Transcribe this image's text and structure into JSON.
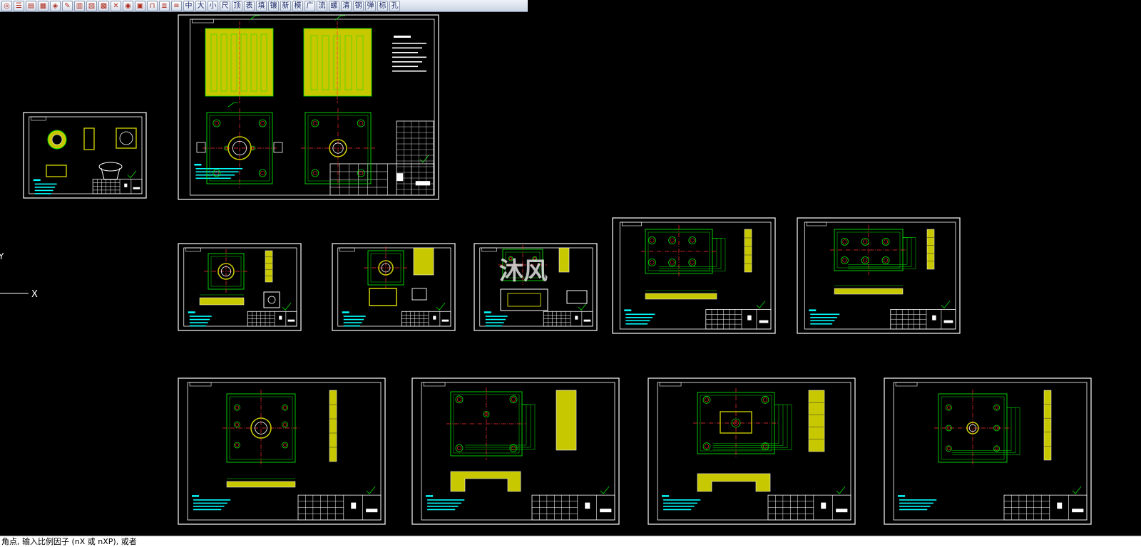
{
  "toolbar": {
    "buttons": [
      {
        "kind": "icon",
        "name": "draw-circle-icon",
        "glyph": "◎"
      },
      {
        "kind": "icon",
        "name": "list-icon",
        "glyph": "☰"
      },
      {
        "kind": "icon",
        "name": "bars-icon",
        "glyph": "▤"
      },
      {
        "kind": "icon",
        "name": "table-icon",
        "glyph": "▦"
      },
      {
        "kind": "icon",
        "name": "shape-icon",
        "glyph": "◈"
      },
      {
        "kind": "icon",
        "name": "pencil-icon",
        "glyph": "✎"
      },
      {
        "kind": "icon",
        "name": "grid-icon",
        "glyph": "▥"
      },
      {
        "kind": "icon",
        "name": "columns-icon",
        "glyph": "▧"
      },
      {
        "kind": "icon",
        "name": "block-icon",
        "glyph": "▩"
      },
      {
        "kind": "icon",
        "name": "tools-icon",
        "glyph": "✕"
      },
      {
        "kind": "icon",
        "name": "target-icon",
        "glyph": "◉"
      },
      {
        "kind": "icon",
        "name": "frame-icon",
        "glyph": "▣"
      },
      {
        "kind": "icon",
        "name": "dimension-icon",
        "glyph": "⊓"
      },
      {
        "kind": "icon",
        "name": "layers-icon",
        "glyph": "≣"
      },
      {
        "kind": "icon",
        "name": "stack-icon",
        "glyph": "≡"
      },
      {
        "kind": "text",
        "name": "center-button",
        "glyph": "中"
      },
      {
        "kind": "text",
        "name": "big-button",
        "glyph": "大"
      },
      {
        "kind": "text",
        "name": "small-button",
        "glyph": "小"
      },
      {
        "kind": "text",
        "name": "size-button",
        "glyph": "尺"
      },
      {
        "kind": "text",
        "name": "top-button",
        "glyph": "顶"
      },
      {
        "kind": "text",
        "name": "table-text-button",
        "glyph": "表"
      },
      {
        "kind": "text",
        "name": "fill-button",
        "glyph": "填"
      },
      {
        "kind": "text",
        "name": "grain-button",
        "glyph": "镶"
      },
      {
        "kind": "text",
        "name": "new-button",
        "glyph": "新"
      },
      {
        "kind": "text",
        "name": "mold-button",
        "glyph": "模"
      },
      {
        "kind": "text",
        "name": "wide-button",
        "glyph": "广"
      },
      {
        "kind": "text",
        "name": "flow-button",
        "glyph": "流"
      },
      {
        "kind": "text",
        "name": "screw-button",
        "glyph": "螺"
      },
      {
        "kind": "text",
        "name": "clear-button",
        "glyph": "清"
      },
      {
        "kind": "text",
        "name": "steel-button",
        "glyph": "钢"
      },
      {
        "kind": "text",
        "name": "spring-button",
        "glyph": "弹"
      },
      {
        "kind": "text",
        "name": "standard-button",
        "glyph": "标"
      },
      {
        "kind": "text",
        "name": "chamfer-button",
        "glyph": "孔"
      }
    ]
  },
  "axis": {
    "y_label": "Y",
    "x_label": "X"
  },
  "watermark": "沐风",
  "colors": {
    "background": "#000000",
    "frame": "#ffffff",
    "part": "#c8c800",
    "outline": "#00e000",
    "center": "#ff3030",
    "text": "#00ffff",
    "hole": "#ff40ff"
  },
  "command_line": "角点, 输入比例因子 (nX 或 nXP), 或者"
}
